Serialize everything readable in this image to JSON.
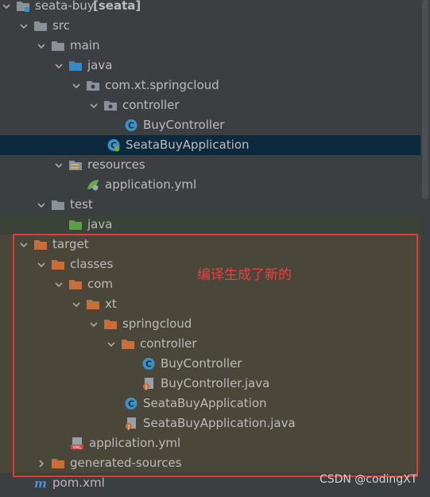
{
  "tree": [
    {
      "label": "seata-buy",
      "suffix": " [seata]",
      "icon": "module-folder-icon"
    },
    {
      "label": "src",
      "icon": "folder-icon"
    },
    {
      "label": "main",
      "icon": "folder-icon"
    },
    {
      "label": "java",
      "icon": "source-folder-icon"
    },
    {
      "label": "com.xt.springcloud",
      "icon": "package-icon"
    },
    {
      "label": "controller",
      "icon": "package-icon"
    },
    {
      "label": "BuyController",
      "icon": "class-icon"
    },
    {
      "label": "SeataBuyApplication",
      "icon": "spring-boot-class-icon"
    },
    {
      "label": "resources",
      "icon": "resources-folder-icon"
    },
    {
      "label": "application.yml",
      "icon": "spring-config-icon"
    },
    {
      "label": "test",
      "icon": "folder-icon"
    },
    {
      "label": "java",
      "icon": "test-source-folder-icon"
    },
    {
      "label": "target",
      "icon": "excluded-folder-icon"
    },
    {
      "label": "classes",
      "icon": "excluded-folder-icon"
    },
    {
      "label": "com",
      "icon": "excluded-folder-icon"
    },
    {
      "label": "xt",
      "icon": "excluded-folder-icon"
    },
    {
      "label": "springcloud",
      "icon": "excluded-folder-icon"
    },
    {
      "label": "controller",
      "icon": "excluded-folder-icon"
    },
    {
      "label": "BuyController",
      "icon": "class-icon"
    },
    {
      "label": "BuyController.java",
      "icon": "java-file-icon"
    },
    {
      "label": "SeataBuyApplication",
      "icon": "class-icon"
    },
    {
      "label": "SeataBuyApplication.java",
      "icon": "java-file-icon"
    },
    {
      "label": "application.yml",
      "icon": "yml-file-icon"
    },
    {
      "label": "generated-sources",
      "icon": "excluded-folder-icon"
    },
    {
      "label": "pom.xml",
      "icon": "maven-icon"
    }
  ],
  "annotation": "编译生成了新的",
  "watermark": "CSDN @codingXT",
  "colors": {
    "highlight_box": "#e03a3a",
    "annotation": "#e8413c",
    "selected_row": "#0d293e"
  }
}
